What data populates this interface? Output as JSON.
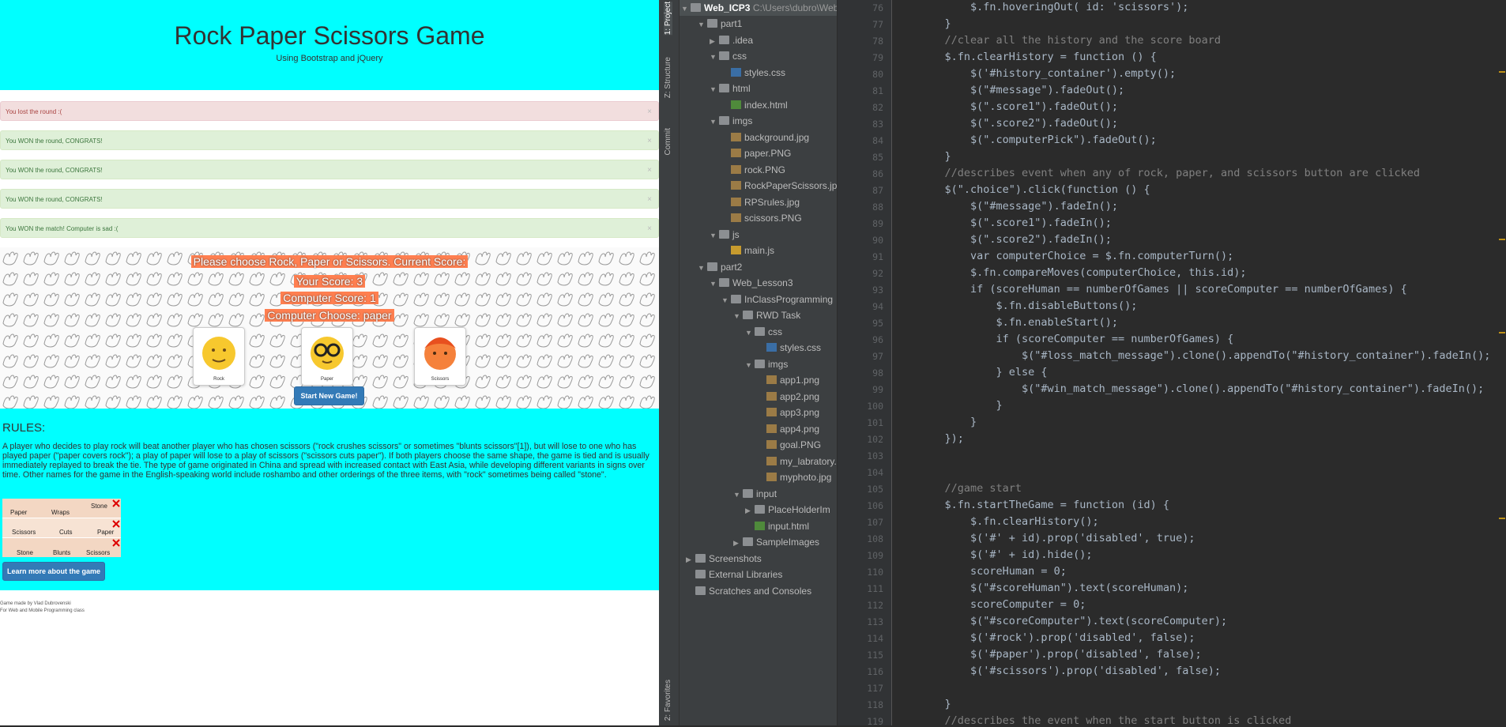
{
  "browser": {
    "title": "Rock Paper Scissors Game",
    "subtitle": "Using Bootstrap and jQuery",
    "history": [
      {
        "text": "You lost the round :(",
        "kind": "loss"
      },
      {
        "text": "You WON the round, CONGRATS!",
        "kind": "win"
      },
      {
        "text": "You WON the round, CONGRATS!",
        "kind": "win"
      },
      {
        "text": "You WON the round, CONGRATS!",
        "kind": "win"
      },
      {
        "text": "You WON the match! Computer is sad :(",
        "kind": "win"
      }
    ],
    "close_glyph": "×",
    "game": {
      "prompt": "Please choose Rock, Paper or Scissors. Current Score:",
      "your_score": "Your Score: 3",
      "computer_score": "Computer Score: 1",
      "computer_choose": "Computer Choose: paper",
      "choices": [
        {
          "label": "Rock",
          "color": "#f7c82e"
        },
        {
          "label": "Paper",
          "color": "#f7c82e"
        },
        {
          "label": "Scissors",
          "color": "#f5813b"
        }
      ],
      "start_button": "Start New Game!"
    },
    "rules": {
      "heading": "RULES:",
      "text": "A player who decides to play rock will beat another player who has chosen scissors (\"rock crushes scissors\" or sometimes \"blunts scissors\"[1]), but will lose to one who has played paper (\"paper covers rock\"); a play of paper will lose to a play of scissors (\"scissors cuts paper\"). If both players choose the same shape, the game is tied and is usually immediately replayed to break the tie. The type of game originated in China and spread with increased contact with East Asia, while developing different variants in signs over time. Other names for the game in the English-speaking world include roshambo and other orderings of the three items, with \"rock\" sometimes being called \"stone\".",
      "image_words": [
        "Paper",
        "Wraps",
        "Stone",
        "Scissors",
        "Cuts",
        "Paper",
        "Stone",
        "Blunts",
        "Scissors"
      ],
      "learn_button": "Learn more about the game"
    },
    "footer": [
      "Game made by Vlad Dubrovenski",
      "For Web and Mobile Programming class"
    ]
  },
  "ide": {
    "side_tabs": [
      "1: Project",
      "Z: Structure",
      "Commit",
      "2: Favorites"
    ],
    "project_root": "Web_ICP3",
    "project_path": "C:\\Users\\dubro\\WebM",
    "tree": [
      {
        "label": "part1",
        "type": "folder",
        "open": true,
        "level": 1
      },
      {
        "label": ".idea",
        "type": "folder",
        "open": false,
        "level": 2
      },
      {
        "label": "css",
        "type": "folder",
        "open": true,
        "level": 2
      },
      {
        "label": "styles.css",
        "type": "css",
        "level": 3
      },
      {
        "label": "html",
        "type": "folder",
        "open": true,
        "level": 2
      },
      {
        "label": "index.html",
        "type": "html",
        "level": 3
      },
      {
        "label": "imgs",
        "type": "folder",
        "open": true,
        "level": 2
      },
      {
        "label": "background.jpg",
        "type": "img",
        "level": 3
      },
      {
        "label": "paper.PNG",
        "type": "img",
        "level": 3
      },
      {
        "label": "rock.PNG",
        "type": "img",
        "level": 3
      },
      {
        "label": "RockPaperScissors.jpg",
        "type": "img",
        "level": 3
      },
      {
        "label": "RPSrules.jpg",
        "type": "img",
        "level": 3
      },
      {
        "label": "scissors.PNG",
        "type": "img",
        "level": 3
      },
      {
        "label": "js",
        "type": "folder",
        "open": true,
        "level": 2
      },
      {
        "label": "main.js",
        "type": "js",
        "level": 3
      },
      {
        "label": "part2",
        "type": "folder",
        "open": true,
        "level": 1
      },
      {
        "label": "Web_Lesson3",
        "type": "folder",
        "open": true,
        "level": 2
      },
      {
        "label": "InClassProgramming",
        "type": "folder",
        "open": true,
        "level": 3
      },
      {
        "label": "RWD Task",
        "type": "folder",
        "open": true,
        "level": 4
      },
      {
        "label": "css",
        "type": "folder",
        "open": true,
        "level": 5
      },
      {
        "label": "styles.css",
        "type": "css",
        "level": 6
      },
      {
        "label": "imgs",
        "type": "folder",
        "open": true,
        "level": 5
      },
      {
        "label": "app1.png",
        "type": "img",
        "level": 6
      },
      {
        "label": "app2.png",
        "type": "img",
        "level": 6
      },
      {
        "label": "app3.png",
        "type": "img",
        "level": 6
      },
      {
        "label": "app4.png",
        "type": "img",
        "level": 6
      },
      {
        "label": "goal.PNG",
        "type": "img",
        "level": 6
      },
      {
        "label": "my_labratory.",
        "type": "img",
        "level": 6
      },
      {
        "label": "myphoto.jpg",
        "type": "img",
        "level": 6
      },
      {
        "label": "input",
        "type": "folder",
        "open": true,
        "level": 4
      },
      {
        "label": "PlaceHolderIm",
        "type": "folder",
        "open": false,
        "level": 5
      },
      {
        "label": "input.html",
        "type": "html",
        "level": 5
      },
      {
        "label": "SampleImages",
        "type": "folder",
        "open": false,
        "level": 4
      },
      {
        "label": "Screenshots",
        "type": "folder",
        "open": false,
        "level": 0
      },
      {
        "label": "External Libraries",
        "type": "lib",
        "level": 0
      },
      {
        "label": "Scratches and Consoles",
        "type": "lib",
        "level": 0
      }
    ],
    "code_lines": [
      {
        "n": "76",
        "t": "        $.fn.hoveringOut( id: 'scissors');",
        "c": ""
      },
      {
        "n": "77",
        "t": "    }",
        "c": ""
      },
      {
        "n": "78",
        "t": "    //clear all the history and the score board",
        "c": "cm"
      },
      {
        "n": "79",
        "t": "    $.fn.clearHistory = function () {",
        "c": ""
      },
      {
        "n": "80",
        "t": "        $('#history_container').empty();",
        "c": ""
      },
      {
        "n": "81",
        "t": "        $(\"#message\").fadeOut();",
        "c": ""
      },
      {
        "n": "82",
        "t": "        $(\".score1\").fadeOut();",
        "c": ""
      },
      {
        "n": "83",
        "t": "        $(\".score2\").fadeOut();",
        "c": ""
      },
      {
        "n": "84",
        "t": "        $(\".computerPick\").fadeOut();",
        "c": ""
      },
      {
        "n": "85",
        "t": "    }",
        "c": ""
      },
      {
        "n": "86",
        "t": "    //describes event when any of rock, paper, and scissors button are clicked",
        "c": "cm"
      },
      {
        "n": "87",
        "t": "    $(\".choice\").click(function () {",
        "c": ""
      },
      {
        "n": "88",
        "t": "        $(\"#message\").fadeIn();",
        "c": ""
      },
      {
        "n": "89",
        "t": "        $(\".score1\").fadeIn();",
        "c": ""
      },
      {
        "n": "90",
        "t": "        $(\".score2\").fadeIn();",
        "c": ""
      },
      {
        "n": "91",
        "t": "        var computerChoice = $.fn.computerTurn();",
        "c": ""
      },
      {
        "n": "92",
        "t": "        $.fn.compareMoves(computerChoice, this.id);",
        "c": ""
      },
      {
        "n": "93",
        "t": "        if (scoreHuman == numberOfGames || scoreComputer == numberOfGames) {",
        "c": ""
      },
      {
        "n": "94",
        "t": "            $.fn.disableButtons();",
        "c": ""
      },
      {
        "n": "95",
        "t": "            $.fn.enableStart();",
        "c": ""
      },
      {
        "n": "96",
        "t": "            if (scoreComputer == numberOfGames) {",
        "c": ""
      },
      {
        "n": "97",
        "t": "                $(\"#loss_match_message\").clone().appendTo(\"#history_container\").fadeIn();",
        "c": ""
      },
      {
        "n": "98",
        "t": "            } else {",
        "c": ""
      },
      {
        "n": "99",
        "t": "                $(\"#win_match_message\").clone().appendTo(\"#history_container\").fadeIn();",
        "c": ""
      },
      {
        "n": "100",
        "t": "            }",
        "c": ""
      },
      {
        "n": "101",
        "t": "        }",
        "c": ""
      },
      {
        "n": "102",
        "t": "    });",
        "c": ""
      },
      {
        "n": "103",
        "t": "",
        "c": ""
      },
      {
        "n": "104",
        "t": "",
        "c": ""
      },
      {
        "n": "105",
        "t": "    //game start",
        "c": "cm"
      },
      {
        "n": "106",
        "t": "    $.fn.startTheGame = function (id) {",
        "c": ""
      },
      {
        "n": "107",
        "t": "        $.fn.clearHistory();",
        "c": ""
      },
      {
        "n": "108",
        "t": "        $('#' + id).prop('disabled', true);",
        "c": ""
      },
      {
        "n": "109",
        "t": "        $('#' + id).hide();",
        "c": ""
      },
      {
        "n": "110",
        "t": "        scoreHuman = 0;",
        "c": ""
      },
      {
        "n": "111",
        "t": "        $(\"#scoreHuman\").text(scoreHuman);",
        "c": ""
      },
      {
        "n": "112",
        "t": "        scoreComputer = 0;",
        "c": ""
      },
      {
        "n": "113",
        "t": "        $(\"#scoreComputer\").text(scoreComputer);",
        "c": ""
      },
      {
        "n": "114",
        "t": "        $('#rock').prop('disabled', false);",
        "c": ""
      },
      {
        "n": "115",
        "t": "        $('#paper').prop('disabled', false);",
        "c": ""
      },
      {
        "n": "116",
        "t": "        $('#scissors').prop('disabled', false);",
        "c": ""
      },
      {
        "n": "117",
        "t": "",
        "c": ""
      },
      {
        "n": "118",
        "t": "    }",
        "c": ""
      },
      {
        "n": "119",
        "t": "    //describes the event when the start button is clicked",
        "c": "cm"
      }
    ]
  }
}
